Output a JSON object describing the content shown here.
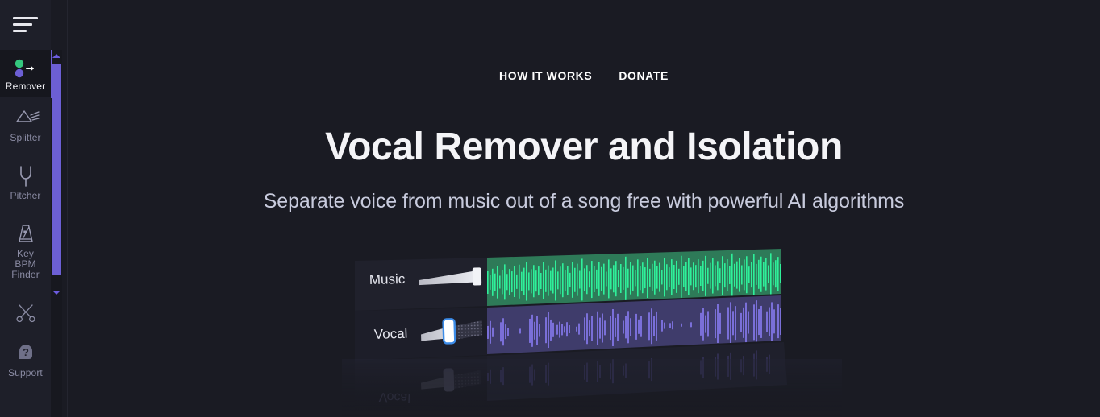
{
  "app": {
    "background_color": "#1a1b23",
    "sidebar_color": "#1e1f29",
    "accent_color": "#6c5fd4"
  },
  "sidebar": {
    "menu_button": {
      "name": "hamburger-menu",
      "label": "Menu"
    },
    "items": [
      {
        "label": "Remover",
        "icon": "remover-icon",
        "active": true
      },
      {
        "label": "Splitter",
        "icon": "splitter-icon",
        "active": false
      },
      {
        "label": "Pitcher",
        "icon": "pitcher-icon",
        "active": false
      },
      {
        "label": "Key\nBPM\nFinder",
        "icon": "metronome-icon",
        "active": false
      },
      {
        "label": "",
        "icon": "scissors-icon",
        "active": false
      },
      {
        "label": "Support",
        "icon": "support-icon",
        "active": false
      }
    ],
    "item_labels": {
      "remover": "Remover",
      "splitter": "Splitter",
      "pitcher": "Pitcher",
      "key_bpm_1": "Key",
      "key_bpm_2": "BPM",
      "key_bpm_3": "Finder",
      "cutter": "",
      "support": "Support"
    },
    "scrollbar": {
      "up_arrow": "scroll-up-arrow",
      "down_arrow": "scroll-down-arrow",
      "thumb_color": "#6c5fd4"
    }
  },
  "topnav": {
    "links": [
      {
        "label": "HOW IT WORKS"
      },
      {
        "label": "DONATE"
      }
    ],
    "how_it_works": "HOW IT WORKS",
    "donate": "DONATE"
  },
  "hero": {
    "title": "Vocal Remover and Isolation",
    "subtitle": "Separate voice from music out of a song free with powerful AI algorithms"
  },
  "illustration": {
    "name": "vocal-remover-mixer-preview",
    "tracks": [
      {
        "label": "Music",
        "fader_value": 100,
        "panel_color": "#2e7a58",
        "wave_color": "#2ff09a",
        "handle_state": "default"
      },
      {
        "label": "Vocal",
        "fader_value": 62,
        "panel_color": "#3f3c6b",
        "wave_color": "#7a6fd8",
        "handle_state": "focused"
      }
    ],
    "reflection_label": "Vocal"
  }
}
